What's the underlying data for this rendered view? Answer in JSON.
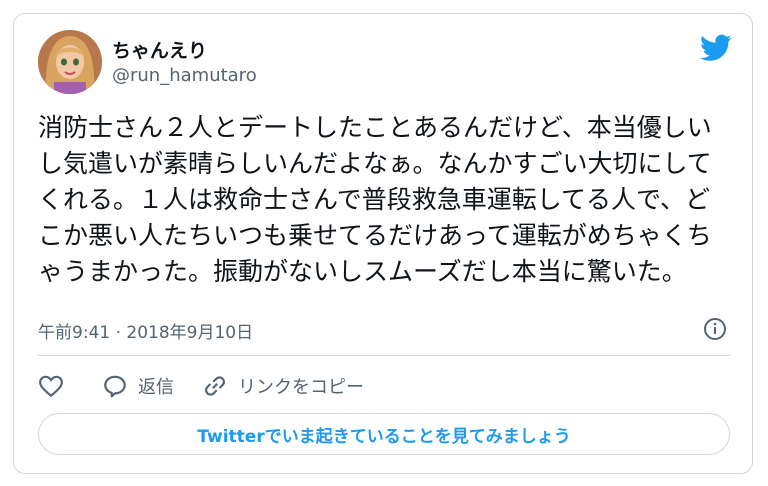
{
  "tweet": {
    "author_name": "ちゃんえり",
    "author_handle": "@run_hamutaro",
    "text": "消防士さん２人とデートしたことあるんだけど、本当優しいし気遣いが素晴らしいんだよなぁ。なんかすごい大切にしてくれる。１人は救命士さんで普段救急車運転してる人で、どこか悪い人たちいつも乗せてるだけあって運転がめちゃくちゃうまかった。振動がないしスムーズだし本当に驚いた。",
    "timestamp": "午前9:41 · 2018年9月10日"
  },
  "actions": {
    "reply_label": "返信",
    "copy_link_label": "リンクをコピー"
  },
  "cta_label": "Twitterでいま起きていることを見てみましょう",
  "colors": {
    "twitter_blue": "#1d9bf0",
    "secondary_text": "#536471",
    "border": "#cfd9de"
  },
  "icons": [
    "twitter-bird-icon",
    "info-icon",
    "heart-icon",
    "reply-bubble-icon",
    "link-icon"
  ]
}
